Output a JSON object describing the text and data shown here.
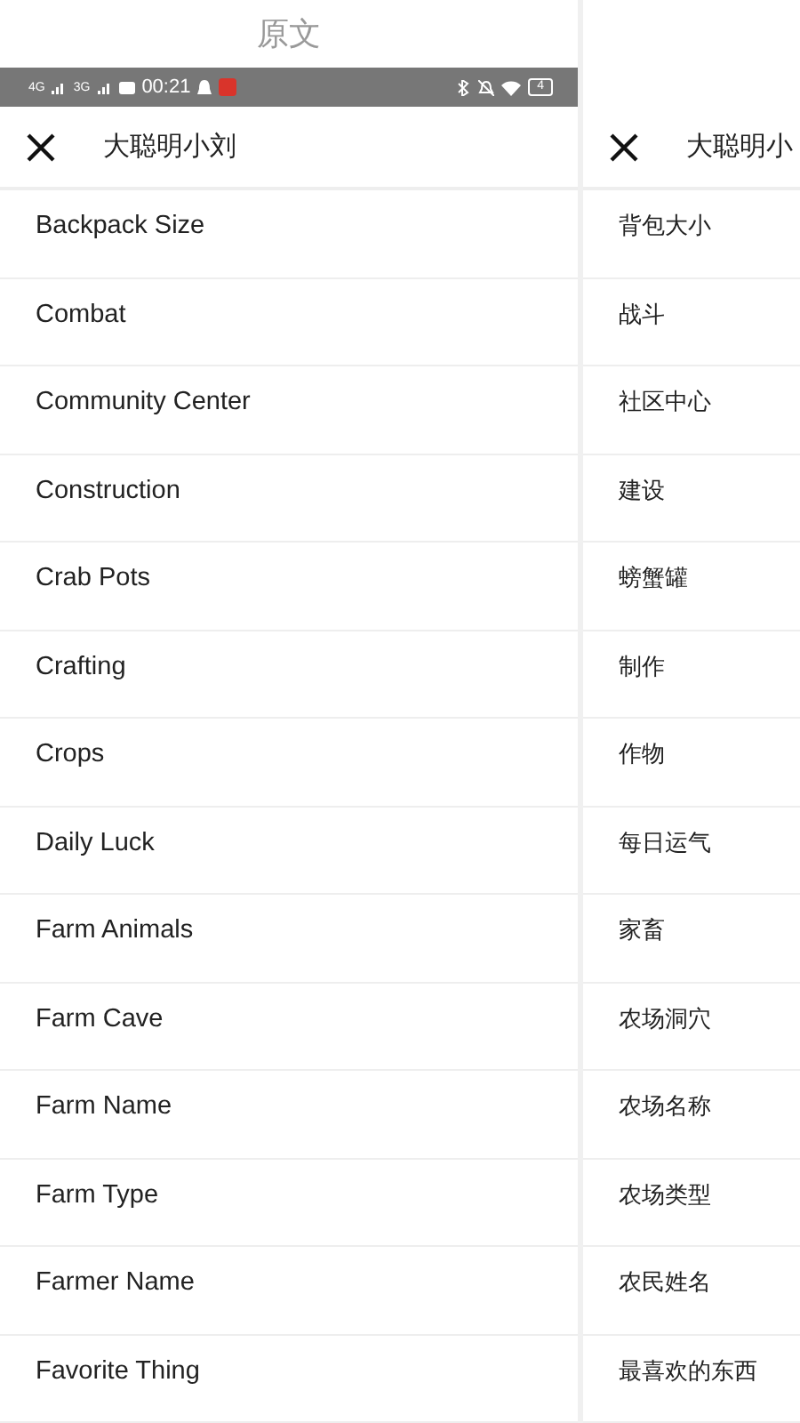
{
  "caption": "原文",
  "status_bar": {
    "network_1": "4G",
    "network_2": "3G",
    "time": "00:21",
    "battery": "4"
  },
  "panes": [
    {
      "kind": "original",
      "header": {
        "title": "大聪明小刘"
      },
      "items": [
        "Backpack Size",
        "Combat",
        "Community Center",
        "Construction",
        "Crab Pots",
        "Crafting",
        "Crops",
        "Daily Luck",
        "Farm Animals",
        "Farm Cave",
        "Farm Name",
        "Farm Type",
        "Farmer Name",
        "Favorite Thing"
      ]
    },
    {
      "kind": "translation",
      "header": {
        "title": "大聪明小"
      },
      "items": [
        "背包大小",
        "战斗",
        "社区中心",
        "建设",
        "螃蟹罐",
        "制作",
        "作物",
        "每日运气",
        "家畜",
        "农场洞穴",
        "农场名称",
        "农场类型",
        "农民姓名",
        "最喜欢的东西"
      ]
    }
  ]
}
